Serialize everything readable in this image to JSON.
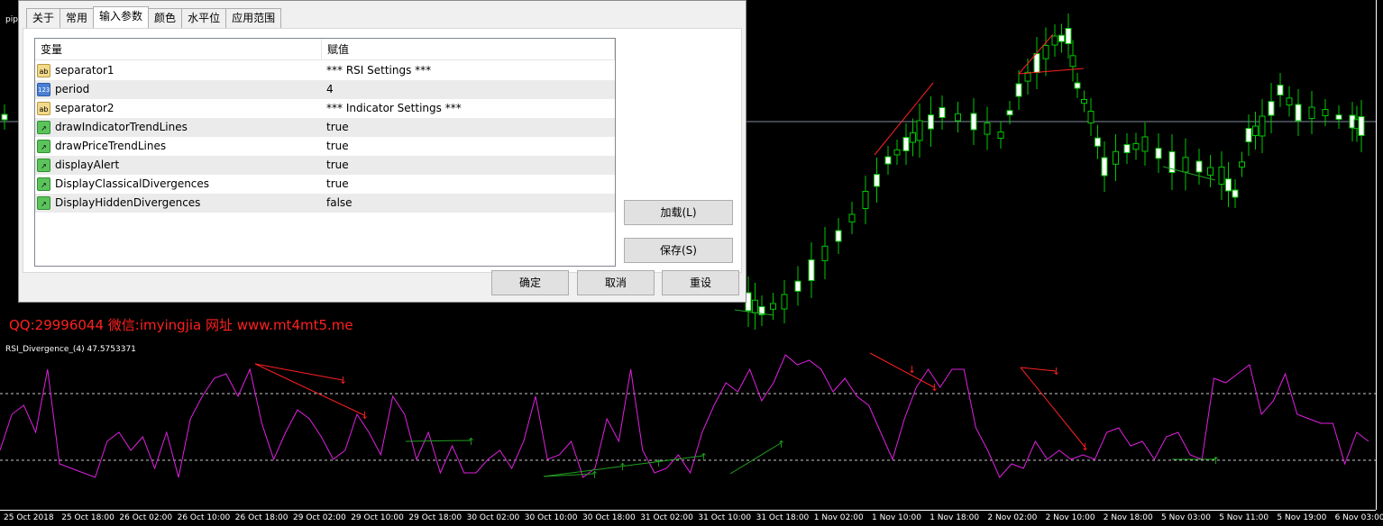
{
  "chart": {
    "price_label": "pip",
    "indicator_label": "RSI_Divergence_(4) 47.5753371",
    "watermark": "QQ:29996044 微信:imyingjia 网址 www.mt4mt5.me",
    "time_ticks": [
      "25 Oct 2018",
      "25 Oct 18:00",
      "26 Oct 02:00",
      "26 Oct 10:00",
      "26 Oct 18:00",
      "29 Oct 02:00",
      "29 Oct 10:00",
      "29 Oct 18:00",
      "30 Oct 02:00",
      "30 Oct 10:00",
      "30 Oct 18:00",
      "31 Oct 02:00",
      "31 Oct 10:00",
      "31 Oct 18:00",
      "1 Nov 02:00",
      "1 Nov 10:00",
      "1 Nov 18:00",
      "2 Nov 02:00",
      "2 Nov 10:00",
      "2 Nov 18:00",
      "5 Nov 03:00",
      "5 Nov 11:00",
      "5 Nov 19:00",
      "6 Nov 03:00"
    ],
    "rsi_levels": [
      70,
      30
    ],
    "colors": {
      "bull": "#ffffff",
      "bear": "#000000",
      "wick": "#00c800",
      "rsi": "#e020e0",
      "bear_div": "#ff2020",
      "bull_div": "#20a020"
    }
  },
  "dialog": {
    "tabs": [
      "关于",
      "常用",
      "输入参数",
      "颜色",
      "水平位",
      "应用范围"
    ],
    "active_tab": "输入参数",
    "columns": {
      "variable": "变量",
      "value": "赋值"
    },
    "rows": [
      {
        "icon": "string-icon",
        "icon_text": "ab",
        "name": "separator1",
        "value": "*** RSI Settings ***"
      },
      {
        "icon": "integer-icon",
        "icon_text": "123",
        "name": "period",
        "value": "4"
      },
      {
        "icon": "string-icon",
        "icon_text": "ab",
        "name": "separator2",
        "value": "*** Indicator Settings ***"
      },
      {
        "icon": "boolean-icon",
        "icon_text": "↗",
        "name": "drawIndicatorTrendLines",
        "value": "true"
      },
      {
        "icon": "boolean-icon",
        "icon_text": "↗",
        "name": "drawPriceTrendLines",
        "value": "true"
      },
      {
        "icon": "boolean-icon",
        "icon_text": "↗",
        "name": "displayAlert",
        "value": "true"
      },
      {
        "icon": "boolean-icon",
        "icon_text": "↗",
        "name": "DisplayClassicalDivergences",
        "value": "true"
      },
      {
        "icon": "boolean-icon",
        "icon_text": "↗",
        "name": "DisplayHiddenDivergences",
        "value": "false"
      }
    ],
    "buttons": {
      "load": "加载(L)",
      "save": "保存(S)",
      "ok": "确定",
      "cancel": "取消",
      "reset": "重设"
    }
  }
}
